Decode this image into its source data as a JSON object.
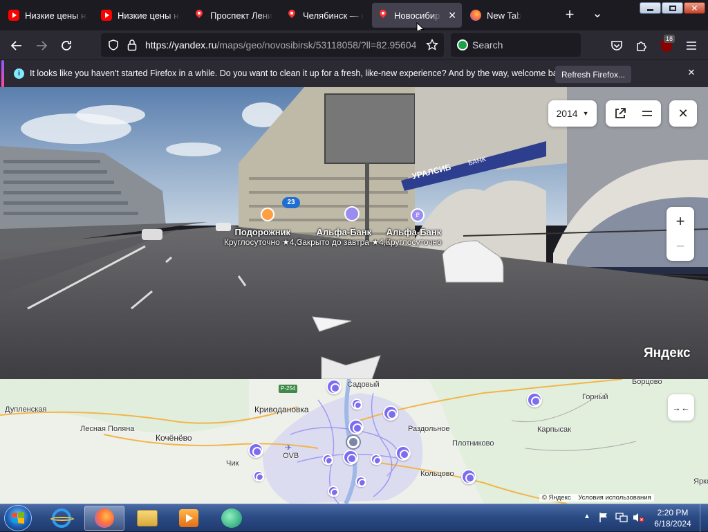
{
  "browser": {
    "tabs": [
      {
        "label": "Низкие цены на",
        "icon": "youtube-icon"
      },
      {
        "label": "Низкие цены на",
        "icon": "youtube-icon"
      },
      {
        "label": "Проспект Ленина",
        "icon": "yandex-maps-icon"
      },
      {
        "label": "Челябинск — ка",
        "icon": "yandex-maps-icon"
      },
      {
        "label": "Новосибирс",
        "icon": "yandex-maps-icon",
        "active": true
      },
      {
        "label": "New Tab",
        "icon": "firefox-icon"
      }
    ],
    "new_tab_symbol": "+",
    "list_tabs_symbol": "⌄",
    "url_host": "https://yandex.ru",
    "url_path": "/maps/geo/novosibirsk/53118058/?ll=82.95604",
    "search_placeholder": "Search",
    "extension_badge": "18"
  },
  "notification": {
    "message": "It looks like you haven't started Firefox in a while. Do you want to clean it up for a fresh, like-new experience? And by the way, welcome back!",
    "button_label": "Refresh Firefox..."
  },
  "panorama": {
    "year": "2014",
    "watermark": "Яндекс",
    "billboard_text": "УРАЛСИБ",
    "billboard_sub": "БАНК",
    "bus_number": "23",
    "pois": [
      {
        "title": "Подорожник",
        "subtitle": "Круглосуточно ★4,0"
      },
      {
        "title": "Альфа-Банк",
        "subtitle": "Закрыто до завтра ★4,5"
      },
      {
        "title": "Альфа-Банк",
        "subtitle": "Круглосуточно"
      }
    ]
  },
  "map": {
    "road_badge": "Р-254",
    "places": [
      "Садовый",
      "Борцово",
      "Горный",
      "Дупленская",
      "Криводановка",
      "Лесная Поляна",
      "Кочёнёво",
      "Раздольное",
      "Карпысак",
      "Плотниково",
      "Чик",
      "ОVВ",
      "Кольцово",
      "Яркое"
    ],
    "copyright": "© Яндекс",
    "terms": "Условия использования"
  },
  "taskbar": {
    "time": "2:20 PM",
    "date": "6/18/2024"
  }
}
